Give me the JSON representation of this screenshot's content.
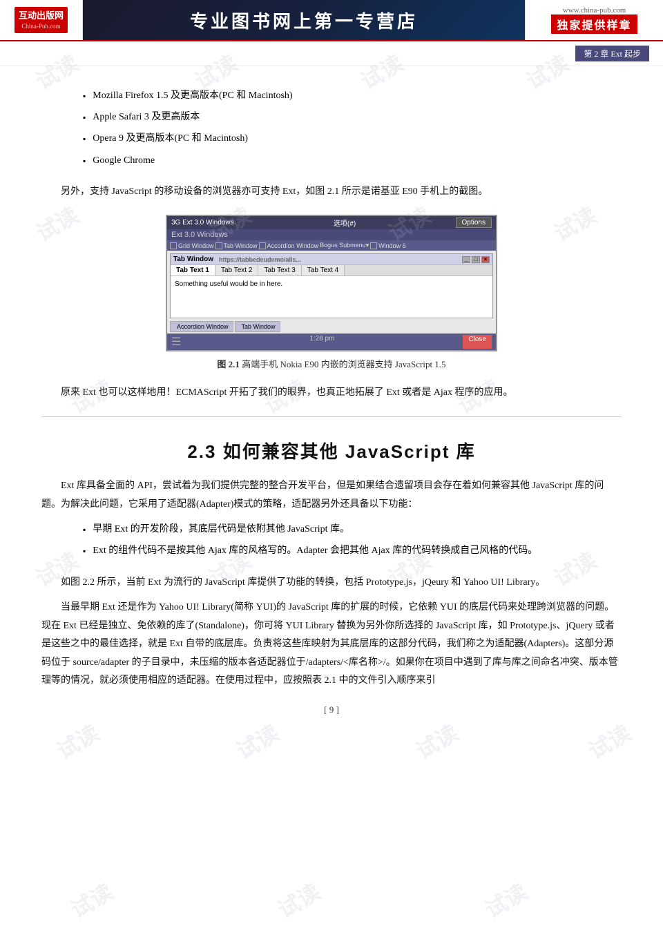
{
  "header": {
    "logo_line1": "互动出版网",
    "logo_line2": "China-Pub.com",
    "title": "专业图书网上第一专营店",
    "site_url": "www.china-pub.com",
    "exclusive": "独家提供样章"
  },
  "chapter_label": "第 2 章   Ext 起步",
  "bullet_items": [
    "Mozilla Firefox 1.5 及更高版本(PC 和 Macintosh)",
    "Apple Safari 3 及更高版本",
    "Opera 9 及更高版本(PC 和 Macintosh)",
    "Google Chrome"
  ],
  "intro_para": "另外，支持 JavaScript 的移动设备的浏览器亦可支持 Ext，如图 2.1 所示是诺基亚 E90 手机上的截图。",
  "figure": {
    "caption_prefix": "图 2.1",
    "caption_text": "   高端手机 Nokia E90 内嵌的浏览器支持 JavaScript 1.5"
  },
  "phone_ui": {
    "status_bar_left": "3G  Ext 3.0 Windows",
    "status_bar_right": "选项(#)",
    "options_label": "Options",
    "app_name": "Ext 3.0 Windows",
    "nav_items": [
      "Grid Window",
      "Tab Window",
      "Accordion Window",
      "Bogus Submenu▾",
      "Window 6"
    ],
    "window_title": "Tab Window",
    "window_url": "https://tabbedeudemo/alls...",
    "tabs": [
      "Tab Text 1",
      "Tab Text 2",
      "Tab Text 3",
      "Tab Text 4"
    ],
    "content_text": "Something useful would be in here.",
    "accordion_items": [
      "Accordion Window",
      "Tab Window"
    ],
    "bottom_time": "1:28 pm",
    "close_label": "Close"
  },
  "para_ext_ecma": "原来 Ext 也可以这样地用！ECMAScript 开拓了我们的眼界，也真正地拓展了 Ext 或者是 Ajax 程序的应用。",
  "section_heading": "2.3   如何兼容其他 JavaScript 库",
  "para1": "Ext 库具备全面的 API，尝试着为我们提供完整的整合开发平台，但是如果结合遗留项目会存在着如何兼容其他 JavaScript 库的问题。为解决此问题，它采用了适配器(Adapter)模式的策略，适配器另外还具备以下功能：",
  "bullet2": [
    "早期 Ext 的开发阶段，其底层代码是依附其他 JavaScript 库。",
    "Ext 的组件代码不是按其他 Ajax 库的风格写的。Adapter 会把其他 Ajax 库的代码转换成自己风格的代码。"
  ],
  "para2": "如图 2.2 所示，当前 Ext 为流行的 JavaScript 库提供了功能的转换，包括 Prototype.js，jQeury 和 Yahoo UI! Library。",
  "para3": "当最早期 Ext 还是作为 Yahoo UI! Library(简称 YUI)的 JavaScript 库的扩展的时候，它依赖 YUI 的底层代码来处理跨浏览器的问题。现在 Ext 已经是独立、免依赖的库了(Standalone)，你可将 YUI Library 替换为另外你所选择的 JavaScript 库，如 Prototype.js、jQuery 或者是这些之中的最佳选择，就是 Ext 自带的底层库。负责将这些库映射为其底层库的这部分代码，我们称之为适配器(Adapters)。这部分源码位于 source/adapter 的子目录中，未压缩的版本各适配器位于/adapters/<库名称>/。如果你在项目中遇到了库与库之间命名冲突、版本管理等的情况，就必须使用相应的适配器。在使用过程中，应按照表 2.1 中的文件引入顺序来引",
  "page_number": "[ 9 ]",
  "watermarks": [
    "试读",
    "试读",
    "试读",
    "试读",
    "试读",
    "试读",
    "试读",
    "试读",
    "试读",
    "试读",
    "试读",
    "试读"
  ]
}
